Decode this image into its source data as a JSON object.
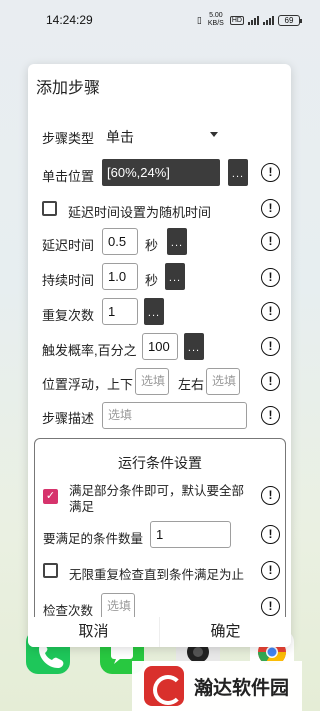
{
  "status_bar": {
    "time": "14:24:29",
    "speed": "5.00 KB/S",
    "network_label": "4G",
    "battery": "69",
    "hd_badge": "HD"
  },
  "dialog": {
    "title": "添加步骤",
    "step_type": {
      "label": "步骤类型",
      "value": "单击"
    },
    "click_position": {
      "label": "单击位置",
      "value": "[60%,24%]",
      "more_button": "..."
    },
    "random_delay": {
      "label": "延迟时间设置为随机时间",
      "checked": false
    },
    "delay": {
      "label": "延迟时间",
      "value": "0.5",
      "unit": "秒",
      "more_button": "..."
    },
    "duration": {
      "label": "持续时间",
      "value": "1.0",
      "unit": "秒",
      "more_button": "..."
    },
    "repeat": {
      "label": "重复次数",
      "value": "1",
      "more_button": "..."
    },
    "trigger": {
      "label": "触发概率,百分之",
      "value": "100",
      "more_button": "..."
    },
    "offset": {
      "label": "位置浮动，上下",
      "vertical_placeholder": "选填",
      "horizontal_label": "左右",
      "horizontal_placeholder": "选填"
    },
    "description": {
      "label": "步骤描述",
      "placeholder": "选填"
    },
    "conditions": {
      "title": "运行条件设置",
      "partial": {
        "label": "满足部分条件即可，默认要全部满足",
        "checked": true
      },
      "required_count": {
        "label": "要满足的条件数量",
        "value": "1"
      },
      "loop_check": {
        "label": "无限重复检查直到条件满足为止",
        "checked": false
      },
      "check_count": {
        "label": "检查次数",
        "placeholder": "选填"
      }
    },
    "info_glyph": "!",
    "cancel_button": "取消",
    "confirm_button": "确定"
  },
  "watermark": {
    "text": "瀚达软件园"
  },
  "colors": {
    "accent": "#d6336c",
    "dark_button": "#3a3a3a",
    "brand": "#d9302c"
  },
  "icons": [
    "info-icon",
    "dropdown-arrow-icon",
    "checkbox-icon",
    "phone-icon",
    "messages-icon",
    "camera-icon",
    "chrome-icon",
    "logo-icon"
  ]
}
